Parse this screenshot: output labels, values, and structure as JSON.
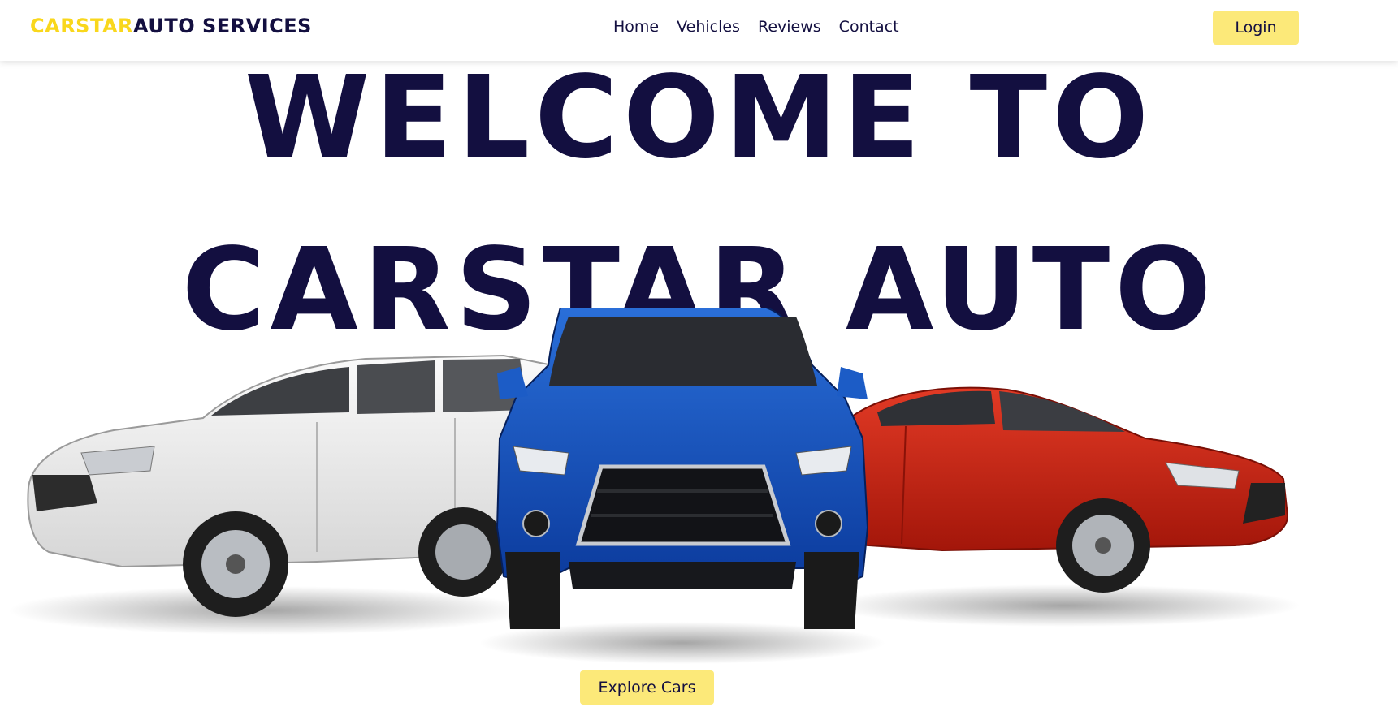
{
  "header": {
    "logo_accent": "CARSTAR",
    "logo_rest": "AUTO SERVICES",
    "nav": [
      "Home",
      "Vehicles",
      "Reviews",
      "Contact"
    ],
    "login_label": "Login"
  },
  "hero": {
    "line1": "WELCOME TO",
    "line2": "CARSTAR AUTO",
    "cta_label": "Explore Cars"
  },
  "colors": {
    "accent": "#f9d71c",
    "button": "#fce979",
    "text": "#130f40"
  }
}
